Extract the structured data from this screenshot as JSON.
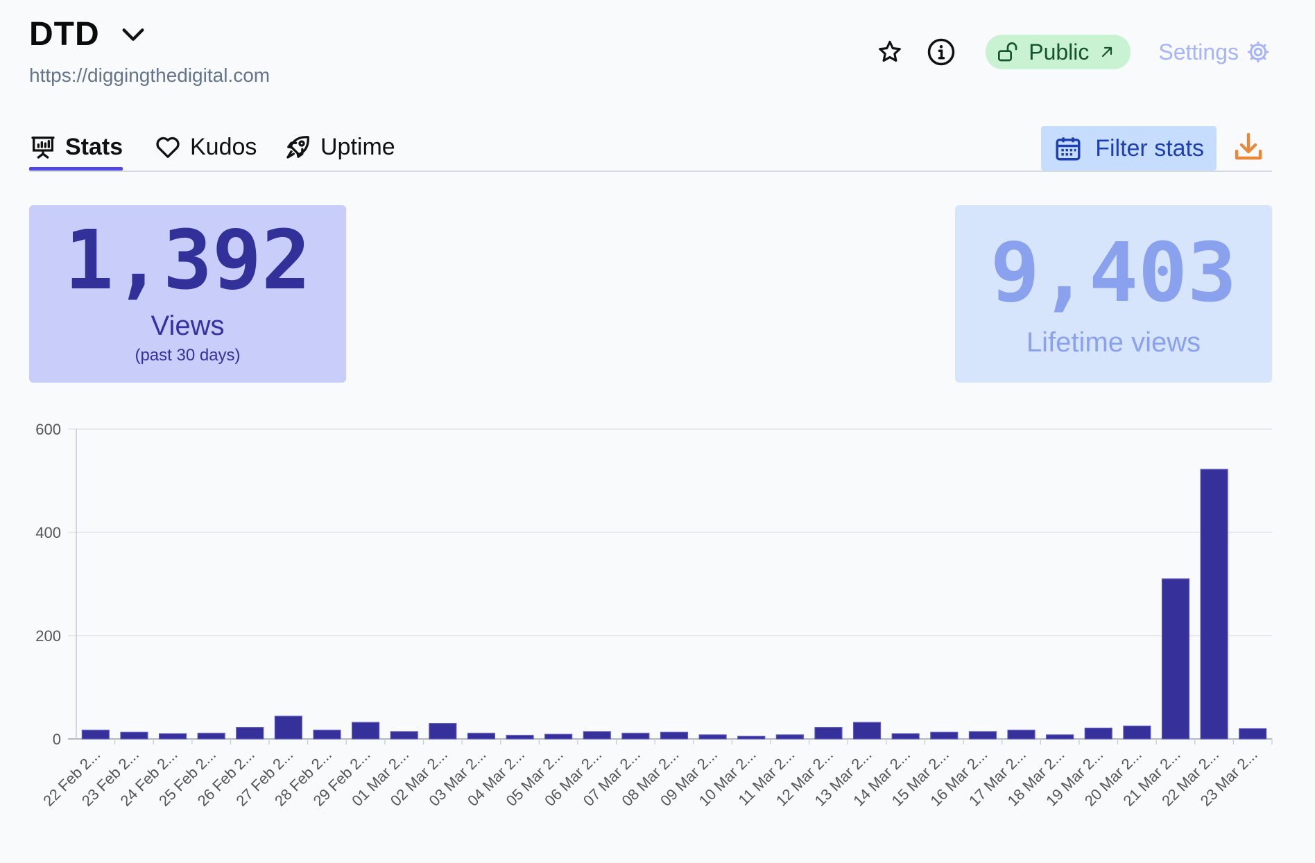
{
  "header": {
    "title": "DTD",
    "url": "https://diggingthedigital.com",
    "public_label": "Public",
    "settings_label": "Settings",
    "icons": [
      "chevron-down-icon",
      "star-icon",
      "info-icon",
      "unlock-icon",
      "external-arrow-icon",
      "gear-icon"
    ]
  },
  "tabs": [
    {
      "label": "Stats",
      "icon": "chart-icon",
      "active": true
    },
    {
      "label": "Kudos",
      "icon": "heart-icon",
      "active": false
    },
    {
      "label": "Uptime",
      "icon": "rocket-icon",
      "active": false
    }
  ],
  "toolbar": {
    "filter_label": "Filter stats",
    "filter_icon": "calendar-icon",
    "download_icon": "download-icon"
  },
  "stats": {
    "views": {
      "value": "1,392",
      "label": "Views",
      "sub": "(past 30 days)"
    },
    "lifetime": {
      "value": "9,403",
      "label": "Lifetime views"
    }
  },
  "colors": {
    "accent": "#4f46e5",
    "bar": "#35309a",
    "public_bg": "#c9f2d3",
    "filter_bg": "#c7ddff",
    "download": "#e8883a"
  },
  "chart_data": {
    "type": "bar",
    "categories": [
      "22 Feb 2...",
      "23 Feb 2...",
      "24 Feb 2...",
      "25 Feb 2...",
      "26 Feb 2...",
      "27 Feb 2...",
      "28 Feb 2...",
      "29 Feb 2...",
      "01 Mar 2...",
      "02 Mar 2...",
      "03 Mar 2...",
      "04 Mar 2...",
      "05 Mar 2...",
      "06 Mar 2...",
      "07 Mar 2...",
      "08 Mar 2...",
      "09 Mar 2...",
      "10 Mar 2...",
      "11 Mar 2...",
      "12 Mar 2...",
      "13 Mar 2...",
      "14 Mar 2...",
      "15 Mar 2...",
      "16 Mar 2...",
      "17 Mar 2...",
      "18 Mar 2...",
      "19 Mar 2...",
      "20 Mar 2...",
      "21 Mar 2...",
      "22 Mar 2...",
      "23 Mar 2..."
    ],
    "values": [
      17,
      13,
      10,
      11,
      22,
      44,
      17,
      32,
      14,
      30,
      11,
      7,
      9,
      14,
      11,
      13,
      8,
      5,
      8,
      22,
      32,
      10,
      13,
      14,
      17,
      8,
      21,
      25,
      310,
      522,
      20
    ],
    "yticks": [
      0,
      200,
      400,
      600
    ],
    "ylim": [
      0,
      600
    ],
    "grid": true
  }
}
